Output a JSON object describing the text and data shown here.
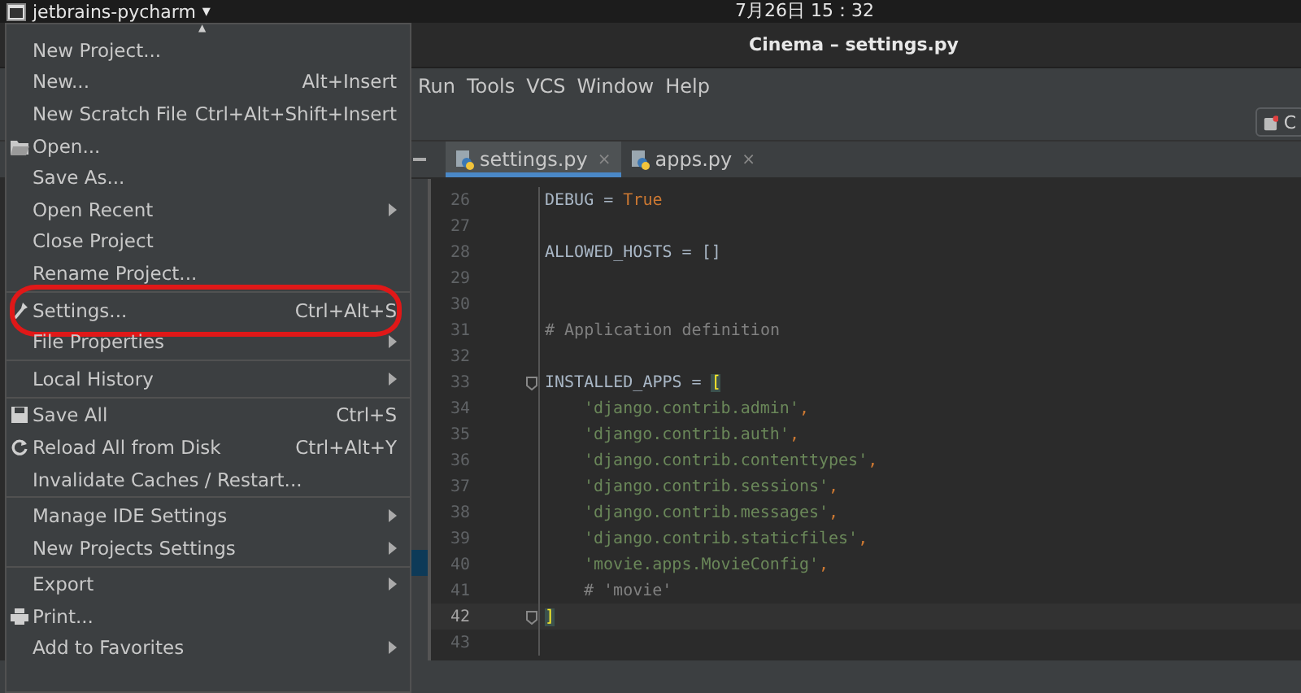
{
  "top_bar": {
    "app_name": "jetbrains-pycharm",
    "app_caret": "▾",
    "clock": "7月26日  15：32"
  },
  "window": {
    "title": "Cinema – settings.py"
  },
  "menu_bar": [
    "Run",
    "Tools",
    "VCS",
    "Window",
    "Help"
  ],
  "toolbar": {
    "button_label": "C"
  },
  "tabs": [
    {
      "label": "settings.py",
      "selected": true,
      "close": "×"
    },
    {
      "label": "apps.py",
      "selected": false,
      "close": "×"
    }
  ],
  "editor": {
    "lines": [
      {
        "number": "26",
        "segments": [
          {
            "kind": "plain",
            "text": "DEBUG = "
          },
          {
            "kind": "keyword",
            "text": "True"
          }
        ]
      },
      {
        "number": "27"
      },
      {
        "number": "28",
        "segments": [
          {
            "kind": "plain",
            "text": "ALLOWED_HOSTS = []"
          }
        ]
      },
      {
        "number": "29"
      },
      {
        "number": "30"
      },
      {
        "number": "31",
        "segments": [
          {
            "kind": "comment",
            "text": "# Application definition"
          }
        ]
      },
      {
        "number": "32"
      },
      {
        "number": "33",
        "fold": true,
        "segments": [
          {
            "kind": "plain",
            "text": "INSTALLED_APPS = "
          },
          {
            "kind": "bracket",
            "text": "["
          }
        ]
      },
      {
        "number": "34",
        "indent": true,
        "segments": [
          {
            "kind": "string",
            "text": "'django.contrib.admin'"
          },
          {
            "kind": "punct",
            "text": ","
          }
        ]
      },
      {
        "number": "35",
        "indent": true,
        "segments": [
          {
            "kind": "string",
            "text": "'django.contrib.auth'"
          },
          {
            "kind": "punct",
            "text": ","
          }
        ]
      },
      {
        "number": "36",
        "indent": true,
        "segments": [
          {
            "kind": "string",
            "text": "'django.contrib.contenttypes'"
          },
          {
            "kind": "punct",
            "text": ","
          }
        ]
      },
      {
        "number": "37",
        "indent": true,
        "segments": [
          {
            "kind": "string",
            "text": "'django.contrib.sessions'"
          },
          {
            "kind": "punct",
            "text": ","
          }
        ]
      },
      {
        "number": "38",
        "indent": true,
        "segments": [
          {
            "kind": "string",
            "text": "'django.contrib.messages'"
          },
          {
            "kind": "punct",
            "text": ","
          }
        ]
      },
      {
        "number": "39",
        "indent": true,
        "segments": [
          {
            "kind": "string",
            "text": "'django.contrib.staticfiles'"
          },
          {
            "kind": "punct",
            "text": ","
          }
        ]
      },
      {
        "number": "40",
        "indent": true,
        "segments": [
          {
            "kind": "string",
            "text": "'movie.apps.MovieConfig'"
          },
          {
            "kind": "punct",
            "text": ","
          }
        ]
      },
      {
        "number": "41",
        "indent": true,
        "segments": [
          {
            "kind": "comment",
            "text": "# 'movie'"
          }
        ]
      },
      {
        "number": "42",
        "current": true,
        "fold": true,
        "segments": [
          {
            "kind": "bracket",
            "text": "]"
          }
        ]
      },
      {
        "number": "43"
      }
    ]
  },
  "file_menu": {
    "scroll_up": "▲",
    "groups": [
      [
        {
          "label": "New Project...",
          "kind": "plain"
        },
        {
          "label": "New...",
          "kind": "plain",
          "shortcut": "Alt+Insert"
        },
        {
          "label": "New Scratch File",
          "kind": "plain",
          "shortcut": "Ctrl+Alt+Shift+Insert"
        },
        {
          "label": "Open...",
          "kind": "open"
        },
        {
          "label": "Save As...",
          "kind": "plain"
        },
        {
          "label": "Open Recent",
          "kind": "plain",
          "submenu": true
        },
        {
          "label": "Close Project",
          "kind": "plain"
        },
        {
          "label": "Rename Project...",
          "kind": "plain"
        }
      ],
      [
        {
          "label": "Settings...",
          "kind": "settings",
          "shortcut": "Ctrl+Alt+S",
          "circled": true
        },
        {
          "label": "File Properties",
          "kind": "plain",
          "submenu": true
        }
      ],
      [
        {
          "label": "Local History",
          "kind": "plain",
          "submenu": true
        }
      ],
      [
        {
          "label": "Save All",
          "kind": "save",
          "shortcut": "Ctrl+S"
        },
        {
          "label": "Reload All from Disk",
          "kind": "reload",
          "shortcut": "Ctrl+Alt+Y"
        },
        {
          "label": "Invalidate Caches / Restart...",
          "kind": "plain"
        }
      ],
      [
        {
          "label": "Manage IDE Settings",
          "kind": "plain",
          "submenu": true
        },
        {
          "label": "New Projects Settings",
          "kind": "plain",
          "submenu": true
        }
      ],
      [
        {
          "label": "Export",
          "kind": "plain",
          "submenu": true
        },
        {
          "label": "Print...",
          "kind": "print"
        },
        {
          "label": "Add to Favorites",
          "kind": "plain",
          "submenu": true
        }
      ]
    ]
  }
}
